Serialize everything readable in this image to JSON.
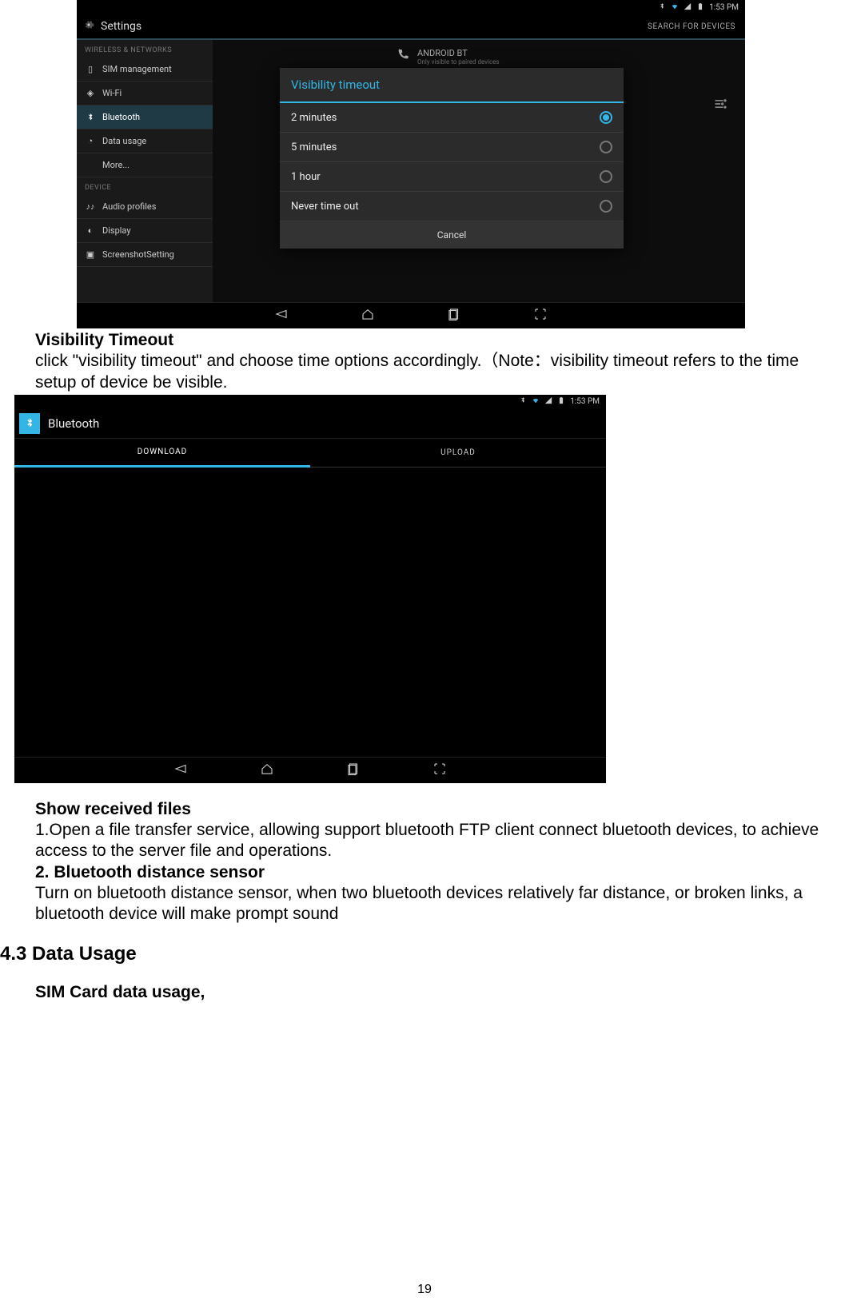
{
  "screenshot1": {
    "statusbar": {
      "time": "1:53 PM"
    },
    "header": {
      "title": "Settings",
      "search_label": "SEARCH FOR DEVICES"
    },
    "sidebar": {
      "section1": "WIRELESS & NETWORKS",
      "items1": [
        "SIM management",
        "Wi-Fi",
        "Bluetooth",
        "Data usage",
        "More..."
      ],
      "section2": "DEVICE",
      "items2": [
        "Audio profiles",
        "Display",
        "ScreenshotSetting"
      ]
    },
    "bt_device": {
      "name": "ANDROID BT",
      "sub": "Only visible to paired devices"
    },
    "modal": {
      "title": "Visibility timeout",
      "options": [
        "2 minutes",
        "5 minutes",
        "1 hour",
        "Never time out"
      ],
      "selected_index": 0,
      "cancel": "Cancel"
    }
  },
  "text1": {
    "heading": "Visibility Timeout",
    "body": "click \"visibility timeout\" and choose time options accordingly.（Note：visibility timeout refers to the time setup of device be visible."
  },
  "screenshot2": {
    "statusbar": {
      "time": "1:53 PM"
    },
    "title": "Bluetooth",
    "tabs": [
      "DOWNLOAD",
      "UPLOAD"
    ],
    "active_tab": 0
  },
  "text2": {
    "h1": "Show received files",
    "p1": "1.Open a file transfer service, allowing support bluetooth FTP client connect bluetooth devices, to achieve access to the server file and operations.",
    "h2": "2. Bluetooth distance sensor",
    "p2": "Turn on bluetooth distance sensor, when two bluetooth devices relatively far distance, or broken links, a bluetooth device will make prompt sound"
  },
  "section_heading": "4.3 Data Usage",
  "sub_heading": "SIM Card data usage,",
  "page_number": "19"
}
